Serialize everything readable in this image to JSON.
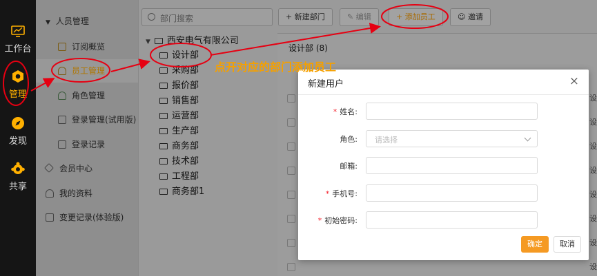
{
  "rail": {
    "items": [
      {
        "label": "工作台",
        "icon": "monitor-icon"
      },
      {
        "label": "管理",
        "icon": "gear-hexagon-icon"
      },
      {
        "label": "发现",
        "icon": "compass-icon"
      },
      {
        "label": "共享",
        "icon": "share-people-icon"
      }
    ]
  },
  "nav": {
    "section_title": "人员管理",
    "items": [
      {
        "label": "订阅概览",
        "icon": "grid-icon"
      },
      {
        "label": "员工管理",
        "icon": "user-icon"
      },
      {
        "label": "角色管理",
        "icon": "user-role-icon"
      },
      {
        "label": "登录管理(试用版)",
        "icon": "monitor-icon"
      },
      {
        "label": "登录记录",
        "icon": "edit-icon"
      },
      {
        "label": "会员中心",
        "icon": "diamond-icon"
      },
      {
        "label": "我的资料",
        "icon": "person-icon"
      },
      {
        "label": "变更记录(体验版)",
        "icon": "edit-icon"
      }
    ]
  },
  "tree": {
    "search_placeholder": "部门搜索",
    "root": "西安电气有限公司",
    "departments": [
      "设计部",
      "采购部",
      "报价部",
      "销售部",
      "运营部",
      "生产部",
      "商务部",
      "技术部",
      "工程部",
      "商务部1"
    ]
  },
  "toolbar": {
    "new_dept": "新建部门",
    "edit": "编辑",
    "add_employee": "添加员工",
    "invite": "邀请"
  },
  "main": {
    "title": "设计部 (8)",
    "ghost_cell": "设"
  },
  "modal": {
    "title": "新建用户",
    "fields": [
      {
        "label": "姓名:",
        "required": true,
        "placeholder": ""
      },
      {
        "label": "角色:",
        "required": false,
        "placeholder": "请选择"
      },
      {
        "label": "邮箱:",
        "required": false,
        "placeholder": ""
      },
      {
        "label": "手机号:",
        "required": true,
        "placeholder": ""
      },
      {
        "label": "初始密码:",
        "required": true,
        "placeholder": ""
      }
    ],
    "ok": "确定",
    "cancel": "取消"
  },
  "annotation": {
    "text": "点开对应的部门添加员工",
    "color": "#f5a000",
    "mark_color": "#e60012"
  }
}
